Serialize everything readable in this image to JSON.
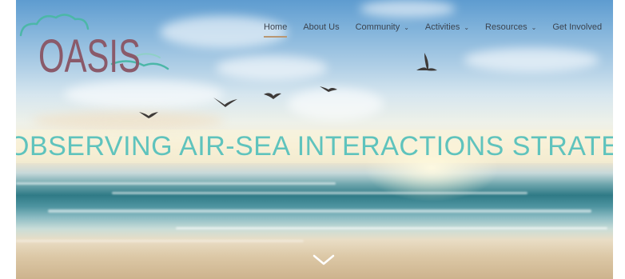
{
  "brand": {
    "logo_text": "OASIS"
  },
  "nav": {
    "items": [
      {
        "label": "Home",
        "active": true,
        "dropdown": false
      },
      {
        "label": "About Us",
        "active": false,
        "dropdown": false
      },
      {
        "label": "Community",
        "active": false,
        "dropdown": true
      },
      {
        "label": "Activities",
        "active": false,
        "dropdown": true
      },
      {
        "label": "Resources",
        "active": false,
        "dropdown": true
      },
      {
        "label": "Get Involved",
        "active": false,
        "dropdown": false
      }
    ],
    "active_underline_color": "#b99773"
  },
  "hero": {
    "headline": "OBSERVING AIR-SEA INTERACTIONS STRATEGY",
    "headline_color": "#5fc3bd",
    "scroll_icon": "chevron-down-icon"
  },
  "colors": {
    "logo_text": "#8a5a6a",
    "logo_cloud": "#4cb7a8",
    "nav_text": "#3b4450"
  }
}
